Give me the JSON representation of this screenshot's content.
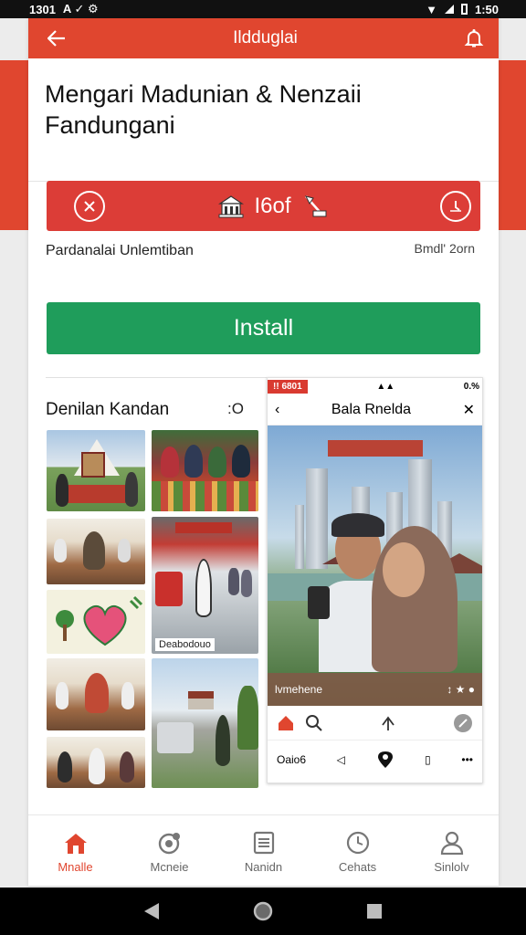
{
  "status": {
    "time_left": "1301",
    "time_right": "1:50",
    "left_glyphs": "A ✓ ⚙"
  },
  "app_bar": {
    "title": "Ildduglai",
    "back_icon": "arrow-left-icon",
    "bell_icon": "bell-icon"
  },
  "heading": "Mengari Madunian & Nenzaii Fandungani",
  "banner": {
    "title": "I6of",
    "left_icon": "close-circle-icon",
    "right_icon": "timer-icon",
    "building_icon": "building-icon",
    "flag_icon": "flag-icon"
  },
  "subtitle": {
    "left": "Pardanalai Unlemtiban",
    "right": "Bmdl' 2orn"
  },
  "install_label": "Install",
  "section": {
    "title": "Denilan Kandan",
    "more": ":O"
  },
  "thumbnails": [
    {
      "caption": ""
    },
    {
      "caption": ""
    },
    {
      "caption": ""
    },
    {
      "caption": "Deabodouo"
    },
    {
      "caption": ""
    },
    {
      "caption": ""
    },
    {
      "caption": ""
    }
  ],
  "mock": {
    "status_left": "!! 6801",
    "status_right": "0.%",
    "title": "Bala Rnelda",
    "sign": "",
    "overlay_label": "lvmehene",
    "bottom_label": "Oaio6"
  },
  "nav": [
    {
      "label": "Mnalle",
      "icon": "home-icon",
      "active": true
    },
    {
      "label": "Mcneie",
      "icon": "discover-icon",
      "active": false
    },
    {
      "label": "Nanidn",
      "icon": "list-icon",
      "active": false
    },
    {
      "label": "Cehats",
      "icon": "clock-icon",
      "active": false
    },
    {
      "label": "Sinlolv",
      "icon": "user-icon",
      "active": false
    }
  ],
  "colors": {
    "accent": "#e0462f",
    "banner": "#dc3d37",
    "install": "#1f9d5b"
  }
}
